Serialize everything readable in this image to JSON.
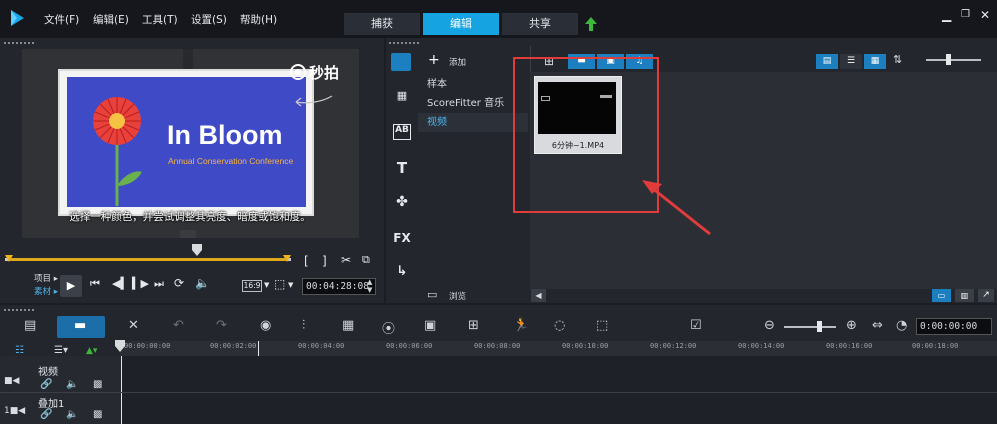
{
  "menu": {
    "file": "文件(F)",
    "edit": "编辑(E)",
    "tools": "工具(T)",
    "settings": "设置(S)",
    "help": "帮助(H)"
  },
  "tabs": {
    "capture": "捕获",
    "edit": "编辑",
    "share": "共享"
  },
  "preview": {
    "slide_title": "In Bloom",
    "slide_subtitle": "Annual Conservation Conference",
    "watermark": "秒拍",
    "subtitle": "选择一种颜色，并尝试调整其亮度、暗度或饱和度。",
    "mode_project": "项目",
    "mode_clip": "素材",
    "aspect": "16:9",
    "timecode": "00:04:28:08"
  },
  "library": {
    "add_label": "添加",
    "folders": [
      "样本",
      "ScoreFitter 音乐",
      "视频"
    ],
    "browse_label": "浏览",
    "thumbnail_caption": "6分钟~1.MP4"
  },
  "timeline": {
    "timecode": "0:00:00:00",
    "ruler": [
      "00:00:00:00",
      "00:00:02:00",
      "00:00:04:00",
      "00:00:06:00",
      "00:00:08:00",
      "00:00:10:00",
      "00:00:12:00",
      "00:00:14:00",
      "00:00:16:00",
      "00:00:18:00"
    ],
    "tracks": [
      "视频",
      "叠加1"
    ]
  },
  "colors": {
    "accent": "#16a3e2",
    "annotation": "#e03c3c",
    "slide_bg": "#3f4ac7"
  }
}
